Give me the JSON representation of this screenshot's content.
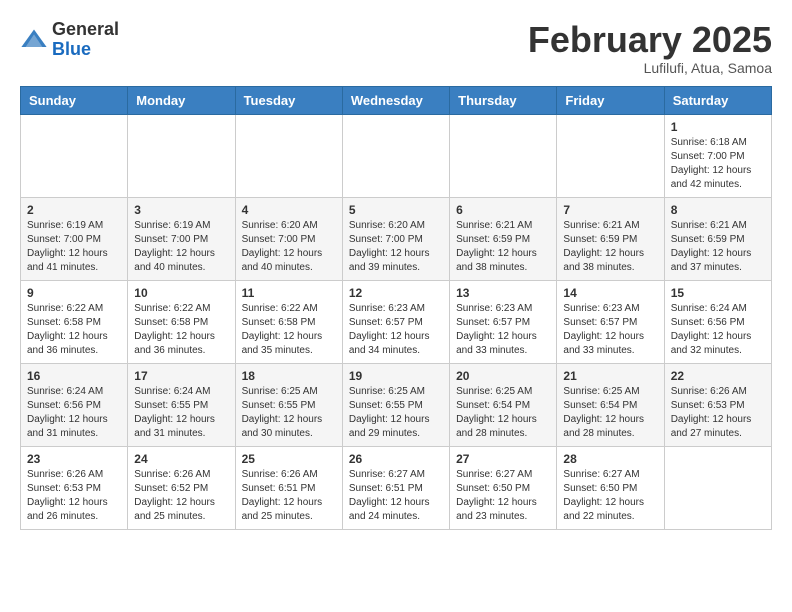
{
  "header": {
    "logo_line1": "General",
    "logo_line2": "Blue",
    "month": "February 2025",
    "location": "Lufilufi, Atua, Samoa"
  },
  "weekdays": [
    "Sunday",
    "Monday",
    "Tuesday",
    "Wednesday",
    "Thursday",
    "Friday",
    "Saturday"
  ],
  "weeks": [
    [
      {
        "day": "",
        "info": ""
      },
      {
        "day": "",
        "info": ""
      },
      {
        "day": "",
        "info": ""
      },
      {
        "day": "",
        "info": ""
      },
      {
        "day": "",
        "info": ""
      },
      {
        "day": "",
        "info": ""
      },
      {
        "day": "1",
        "info": "Sunrise: 6:18 AM\nSunset: 7:00 PM\nDaylight: 12 hours\nand 42 minutes."
      }
    ],
    [
      {
        "day": "2",
        "info": "Sunrise: 6:19 AM\nSunset: 7:00 PM\nDaylight: 12 hours\nand 41 minutes."
      },
      {
        "day": "3",
        "info": "Sunrise: 6:19 AM\nSunset: 7:00 PM\nDaylight: 12 hours\nand 40 minutes."
      },
      {
        "day": "4",
        "info": "Sunrise: 6:20 AM\nSunset: 7:00 PM\nDaylight: 12 hours\nand 40 minutes."
      },
      {
        "day": "5",
        "info": "Sunrise: 6:20 AM\nSunset: 7:00 PM\nDaylight: 12 hours\nand 39 minutes."
      },
      {
        "day": "6",
        "info": "Sunrise: 6:21 AM\nSunset: 6:59 PM\nDaylight: 12 hours\nand 38 minutes."
      },
      {
        "day": "7",
        "info": "Sunrise: 6:21 AM\nSunset: 6:59 PM\nDaylight: 12 hours\nand 38 minutes."
      },
      {
        "day": "8",
        "info": "Sunrise: 6:21 AM\nSunset: 6:59 PM\nDaylight: 12 hours\nand 37 minutes."
      }
    ],
    [
      {
        "day": "9",
        "info": "Sunrise: 6:22 AM\nSunset: 6:58 PM\nDaylight: 12 hours\nand 36 minutes."
      },
      {
        "day": "10",
        "info": "Sunrise: 6:22 AM\nSunset: 6:58 PM\nDaylight: 12 hours\nand 36 minutes."
      },
      {
        "day": "11",
        "info": "Sunrise: 6:22 AM\nSunset: 6:58 PM\nDaylight: 12 hours\nand 35 minutes."
      },
      {
        "day": "12",
        "info": "Sunrise: 6:23 AM\nSunset: 6:57 PM\nDaylight: 12 hours\nand 34 minutes."
      },
      {
        "day": "13",
        "info": "Sunrise: 6:23 AM\nSunset: 6:57 PM\nDaylight: 12 hours\nand 33 minutes."
      },
      {
        "day": "14",
        "info": "Sunrise: 6:23 AM\nSunset: 6:57 PM\nDaylight: 12 hours\nand 33 minutes."
      },
      {
        "day": "15",
        "info": "Sunrise: 6:24 AM\nSunset: 6:56 PM\nDaylight: 12 hours\nand 32 minutes."
      }
    ],
    [
      {
        "day": "16",
        "info": "Sunrise: 6:24 AM\nSunset: 6:56 PM\nDaylight: 12 hours\nand 31 minutes."
      },
      {
        "day": "17",
        "info": "Sunrise: 6:24 AM\nSunset: 6:55 PM\nDaylight: 12 hours\nand 31 minutes."
      },
      {
        "day": "18",
        "info": "Sunrise: 6:25 AM\nSunset: 6:55 PM\nDaylight: 12 hours\nand 30 minutes."
      },
      {
        "day": "19",
        "info": "Sunrise: 6:25 AM\nSunset: 6:55 PM\nDaylight: 12 hours\nand 29 minutes."
      },
      {
        "day": "20",
        "info": "Sunrise: 6:25 AM\nSunset: 6:54 PM\nDaylight: 12 hours\nand 28 minutes."
      },
      {
        "day": "21",
        "info": "Sunrise: 6:25 AM\nSunset: 6:54 PM\nDaylight: 12 hours\nand 28 minutes."
      },
      {
        "day": "22",
        "info": "Sunrise: 6:26 AM\nSunset: 6:53 PM\nDaylight: 12 hours\nand 27 minutes."
      }
    ],
    [
      {
        "day": "23",
        "info": "Sunrise: 6:26 AM\nSunset: 6:53 PM\nDaylight: 12 hours\nand 26 minutes."
      },
      {
        "day": "24",
        "info": "Sunrise: 6:26 AM\nSunset: 6:52 PM\nDaylight: 12 hours\nand 25 minutes."
      },
      {
        "day": "25",
        "info": "Sunrise: 6:26 AM\nSunset: 6:51 PM\nDaylight: 12 hours\nand 25 minutes."
      },
      {
        "day": "26",
        "info": "Sunrise: 6:27 AM\nSunset: 6:51 PM\nDaylight: 12 hours\nand 24 minutes."
      },
      {
        "day": "27",
        "info": "Sunrise: 6:27 AM\nSunset: 6:50 PM\nDaylight: 12 hours\nand 23 minutes."
      },
      {
        "day": "28",
        "info": "Sunrise: 6:27 AM\nSunset: 6:50 PM\nDaylight: 12 hours\nand 22 minutes."
      },
      {
        "day": "",
        "info": ""
      }
    ]
  ]
}
